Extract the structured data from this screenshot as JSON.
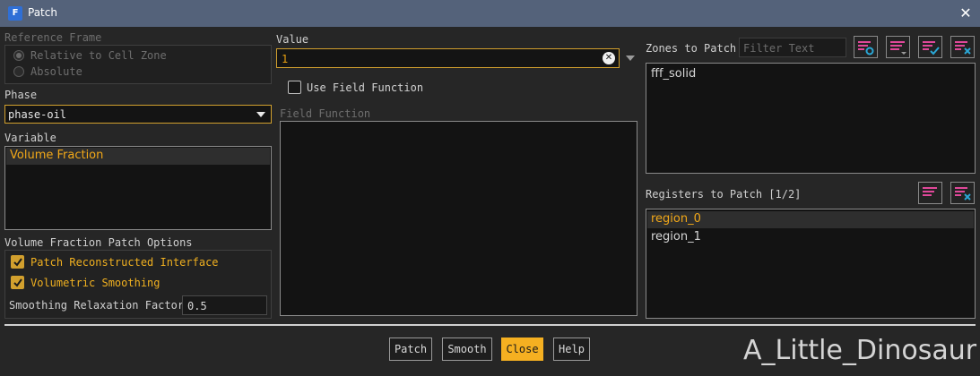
{
  "window": {
    "title": "Patch",
    "app_icon_letter": "F",
    "close_glyph": "✕"
  },
  "reference_frame": {
    "label": "Reference Frame",
    "options": [
      {
        "label": "Relative to Cell Zone",
        "selected": true
      },
      {
        "label": "Absolute",
        "selected": false
      }
    ]
  },
  "phase": {
    "label": "Phase",
    "value": "phase-oil"
  },
  "variable": {
    "label": "Variable",
    "items": [
      "Volume Fraction"
    ],
    "selected": "Volume Fraction"
  },
  "vf_options": {
    "label": "Volume Fraction Patch Options",
    "patch_reconstructed": {
      "label": "Patch Reconstructed Interface",
      "checked": true
    },
    "volumetric_smoothing": {
      "label": "Volumetric Smoothing",
      "checked": true
    },
    "relaxation": {
      "label": "Smoothing Relaxation Factor",
      "value": "0.5"
    }
  },
  "value": {
    "label": "Value",
    "value": "1"
  },
  "field_function": {
    "use_label": "Use Field Function",
    "checked": false,
    "label": "Field Function"
  },
  "zones": {
    "label": "Zones to Patch",
    "filter_placeholder": "Filter Text",
    "items": [
      "fff_solid"
    ]
  },
  "registers": {
    "label": "Registers to Patch [1/2]",
    "items": [
      "region_0",
      "region_1"
    ],
    "selected": "region_0"
  },
  "buttons": {
    "patch": "Patch",
    "smooth": "Smooth",
    "close": "Close",
    "help": "Help"
  },
  "watermark": "A_Little_Dinosaur",
  "colors": {
    "accent": "#f5b021",
    "title_bar": "#54627a",
    "background": "#262626",
    "icon_pink": "#e0489a",
    "icon_teal": "#2aa7d6"
  }
}
